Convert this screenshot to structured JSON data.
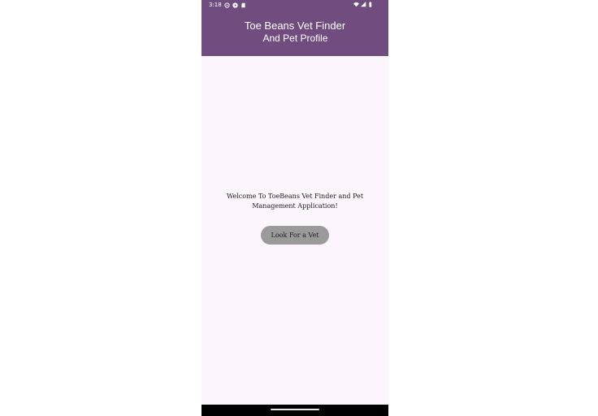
{
  "status_bar": {
    "time": "3:18",
    "left_icons": [
      "whatsapp-icon",
      "media-play-icon",
      "sd-card-icon"
    ],
    "right_icons": [
      "wifi-icon",
      "cell-signal-icon",
      "battery-icon"
    ]
  },
  "app_bar": {
    "title_line1": "Toe Beans Vet Finder",
    "title_line2": "And Pet Profile",
    "background_color": "#704d7e"
  },
  "main": {
    "welcome_text": "Welcome To ToeBeans Vet Finder and Pet Management Application!",
    "look_button_label": "Look For a Vet",
    "button_color": "#9a9a9a",
    "background_color": "#fcf5fe"
  },
  "nav_bar": {
    "handle": "gesture-handle"
  }
}
